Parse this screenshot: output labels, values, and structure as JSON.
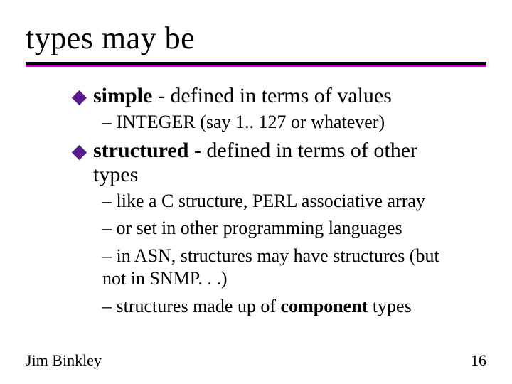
{
  "title": "types may  be",
  "items": [
    {
      "term": "simple",
      "rest": " - defined in terms of values",
      "subs": [
        "– INTEGER (say 1.. 127 or whatever)"
      ]
    },
    {
      "term": "structured",
      "rest": " - defined in terms of other types",
      "subs": [
        "– like a C structure, PERL associative array",
        "– or set in other programming languages",
        "– in ASN, structures may have structures (but not in SNMP. . .)"
      ],
      "tail": {
        "prefix": "– structures made up of ",
        "bold": "component",
        "suffix": " types"
      }
    }
  ],
  "footer": {
    "author": "Jim Binkley",
    "page": "16"
  }
}
